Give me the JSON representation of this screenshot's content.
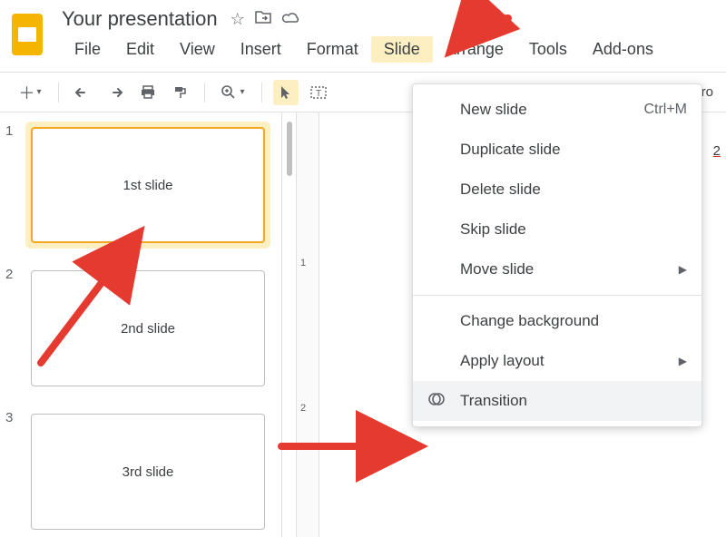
{
  "header": {
    "doc_title": "Your presentation"
  },
  "menu": {
    "file": "File",
    "edit": "Edit",
    "view": "View",
    "insert": "Insert",
    "format": "Format",
    "slide": "Slide",
    "arrange": "Arrange",
    "tools": "Tools",
    "addons": "Add-ons"
  },
  "toolbar": {
    "right_frag1": "kgro",
    "right_frag2": "2"
  },
  "thumbs": [
    {
      "num": "1",
      "label": "1st slide",
      "selected": true
    },
    {
      "num": "2",
      "label": "2nd slide",
      "selected": false
    },
    {
      "num": "3",
      "label": "3rd slide",
      "selected": false
    }
  ],
  "ruler": {
    "t1": "1",
    "t2": "2"
  },
  "slide_menu": {
    "new_slide": "New slide",
    "new_slide_shortcut": "Ctrl+M",
    "duplicate": "Duplicate slide",
    "delete": "Delete slide",
    "skip": "Skip slide",
    "move": "Move slide",
    "change_bg": "Change background",
    "apply_layout": "Apply layout",
    "transition": "Transition"
  }
}
